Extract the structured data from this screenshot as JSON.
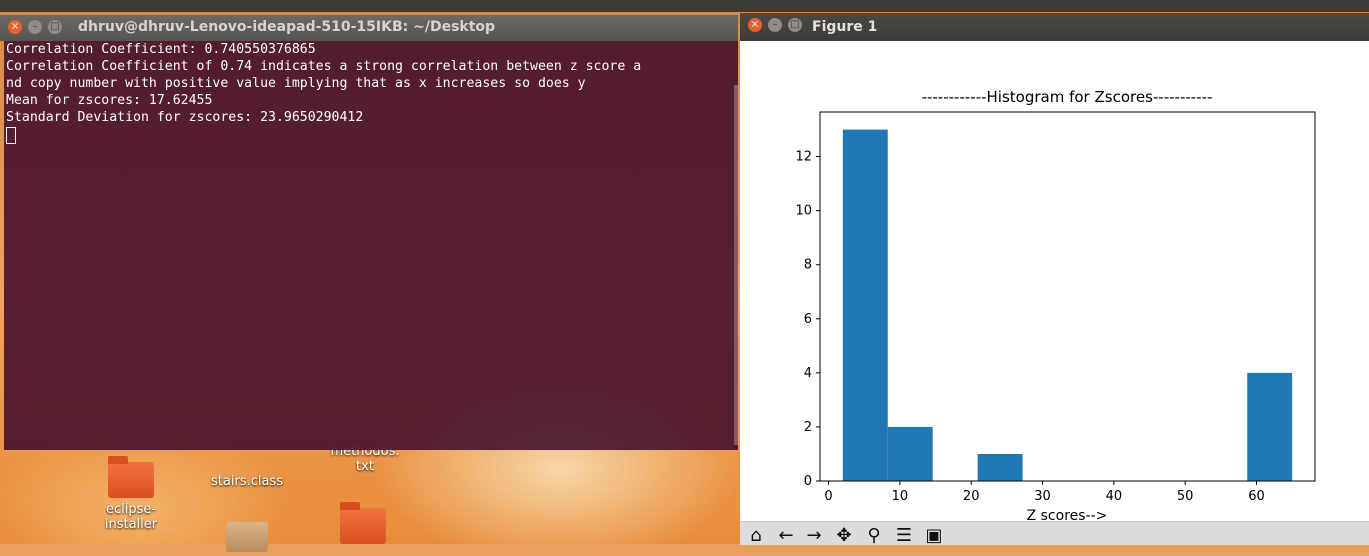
{
  "terminal": {
    "title": "dhruv@dhruv-Lenovo-ideapad-510-15IKB: ~/Desktop",
    "lines": [
      "Correlation Coefficient: 0.740550376865",
      "Correlation Coefficient of 0.74 indicates a strong correlation between z score a",
      "nd copy number with positive value implying that as x increases so does y",
      "Mean for zscores: 17.62455",
      "Standard Deviation for zscores: 23.9650290412"
    ]
  },
  "figure": {
    "title": "Figure 1",
    "toolbar": [
      "home-icon",
      "back-arrow-icon",
      "forward-arrow-icon",
      "pan-icon",
      "zoom-icon",
      "configure-icon",
      "save-icon"
    ]
  },
  "desktop": {
    "icons": [
      {
        "label": "eclipse-\ninstaller",
        "kind": "folder"
      },
      {
        "label": "stairs.class",
        "kind": "file"
      },
      {
        "label": "methodos.\ntxt",
        "kind": "file"
      }
    ]
  },
  "chart_data": {
    "type": "bar",
    "title": "------------Histogram for Zscores-----------",
    "xlabel": "Z scores-->",
    "ylabel": "",
    "bin_edges": [
      2.0,
      8.3,
      14.6,
      20.9,
      27.2,
      33.5,
      39.8,
      46.1,
      52.4,
      58.7,
      65.0
    ],
    "values": [
      13,
      2,
      0,
      1,
      0,
      0,
      0,
      0,
      0,
      4
    ],
    "xlim": [
      -1.2,
      68.2
    ],
    "ylim": [
      0,
      13.65
    ],
    "xticks": [
      0,
      10,
      20,
      30,
      40,
      50,
      60
    ],
    "yticks": [
      0,
      2,
      4,
      6,
      8,
      10,
      12
    ],
    "bar_color": "#1f77b4",
    "grid": false
  }
}
